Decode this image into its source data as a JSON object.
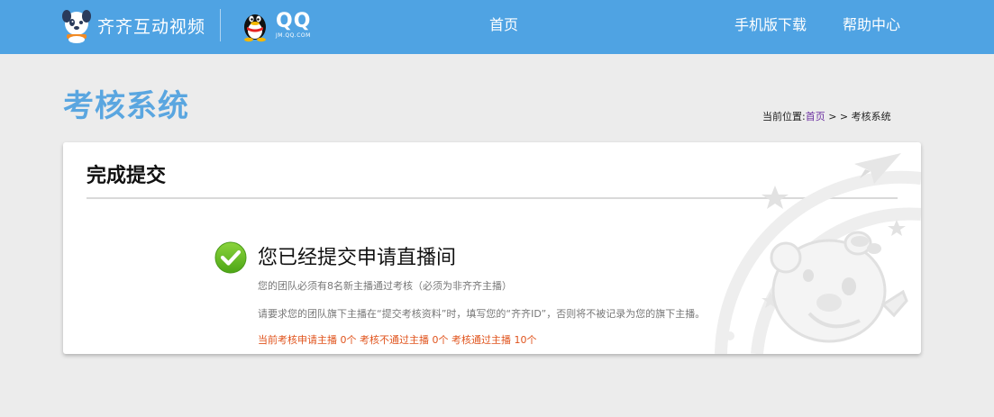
{
  "header": {
    "brand_name": "齐齐互动视频",
    "qq_text": "QQ",
    "qq_domain": "JM.QQ.COM",
    "nav": {
      "home": "首页",
      "mobile": "手机版下载",
      "help": "帮助中心"
    }
  },
  "page": {
    "title": "考核系统",
    "breadcrumb": {
      "prefix": "当前位置:",
      "home": "首页",
      "separator": " > > ",
      "current": "考核系统"
    }
  },
  "card": {
    "title": "完成提交",
    "success_message": "您已经提交申请直播间",
    "note_requirement": "您的团队必须有8名新主播通过考核（必须为非齐齐主播）",
    "note_instruction": "请要求您的团队旗下主播在“提交考核资料”时，填写您的“齐齐ID”，否则将不被记录为您的旗下主播。",
    "stats": "当前考核申请主播 0个 考核不通过主播 0个 考核通过主播 10个"
  },
  "colors": {
    "header_bg": "#4fa3e3",
    "title_blue": "#5aa6e0",
    "success_green": "#6cbf2a",
    "stats_orange": "#e0531c"
  },
  "icons": {
    "brand": "dog-mascot-icon",
    "qq": "qq-penguin-icon",
    "success": "check-circle-icon"
  }
}
